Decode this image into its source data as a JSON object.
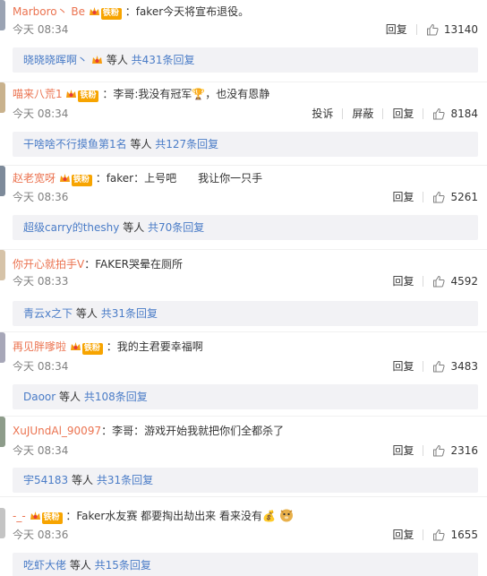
{
  "comments": [
    {
      "user": "Marboro丶 Be",
      "badge": "铁粉",
      "text": "：faker今天将宣布退役。",
      "time": "今天 08:34",
      "reply_label": "回复",
      "likes": "13140",
      "sub_user": "晓晓晓晖啊丶",
      "sub_rest": " 等人 ",
      "sub_count": "共431条回复"
    },
    {
      "user": "喵来八荒1",
      "badge": "铁粉",
      "text": "：李哥:我没有冠军🏆，也没有恩静",
      "time": "今天 08:34",
      "report_label": "投诉",
      "block_label": "屏蔽",
      "reply_label": "回复",
      "likes": "8184",
      "sub_user": "干啥啥不行摸鱼第1名",
      "sub_rest": " 等人 ",
      "sub_count": "共127条回复"
    },
    {
      "user": "赵老宽呀",
      "badge": "铁粉",
      "text": "：faker：上号吧　　我让你一只手",
      "time": "今天 08:36",
      "reply_label": "回复",
      "likes": "5261",
      "sub_user": "超级carry的theshy",
      "sub_rest": " 等人 ",
      "sub_count": "共70条回复"
    },
    {
      "user": "你开心就拍手V",
      "text": "：FAKER哭晕在厕所",
      "time": "今天 08:33",
      "reply_label": "回复",
      "likes": "4592",
      "sub_user": "青云x之下",
      "sub_rest": " 等人 ",
      "sub_count": "共31条回复"
    },
    {
      "user": "再见胖嗲啦",
      "badge": "铁粉",
      "text": "：我的主君要幸福啊",
      "time": "今天 08:34",
      "reply_label": "回复",
      "likes": "3483",
      "sub_user": "Daoor",
      "sub_rest": " 等人 ",
      "sub_count": "共108条回复"
    },
    {
      "user": "XuJUndAl_90097",
      "text": "：李哥：游戏开始我就把你们全都杀了",
      "time": "今天 08:34",
      "reply_label": "回复",
      "likes": "2316",
      "sub_user": "宇54183",
      "sub_rest": " 等人 ",
      "sub_count": "共31条回复"
    },
    {
      "user": "-_-",
      "badge": "铁粉",
      "text": "：Faker水友赛 都要掏出劫出来  看来没有💰",
      "time": "今天 08:36",
      "reply_label": "回复",
      "likes": "1655",
      "sub_user": "吃虾大佬",
      "sub_rest": " 等人 ",
      "sub_count": "共15条回复"
    }
  ]
}
